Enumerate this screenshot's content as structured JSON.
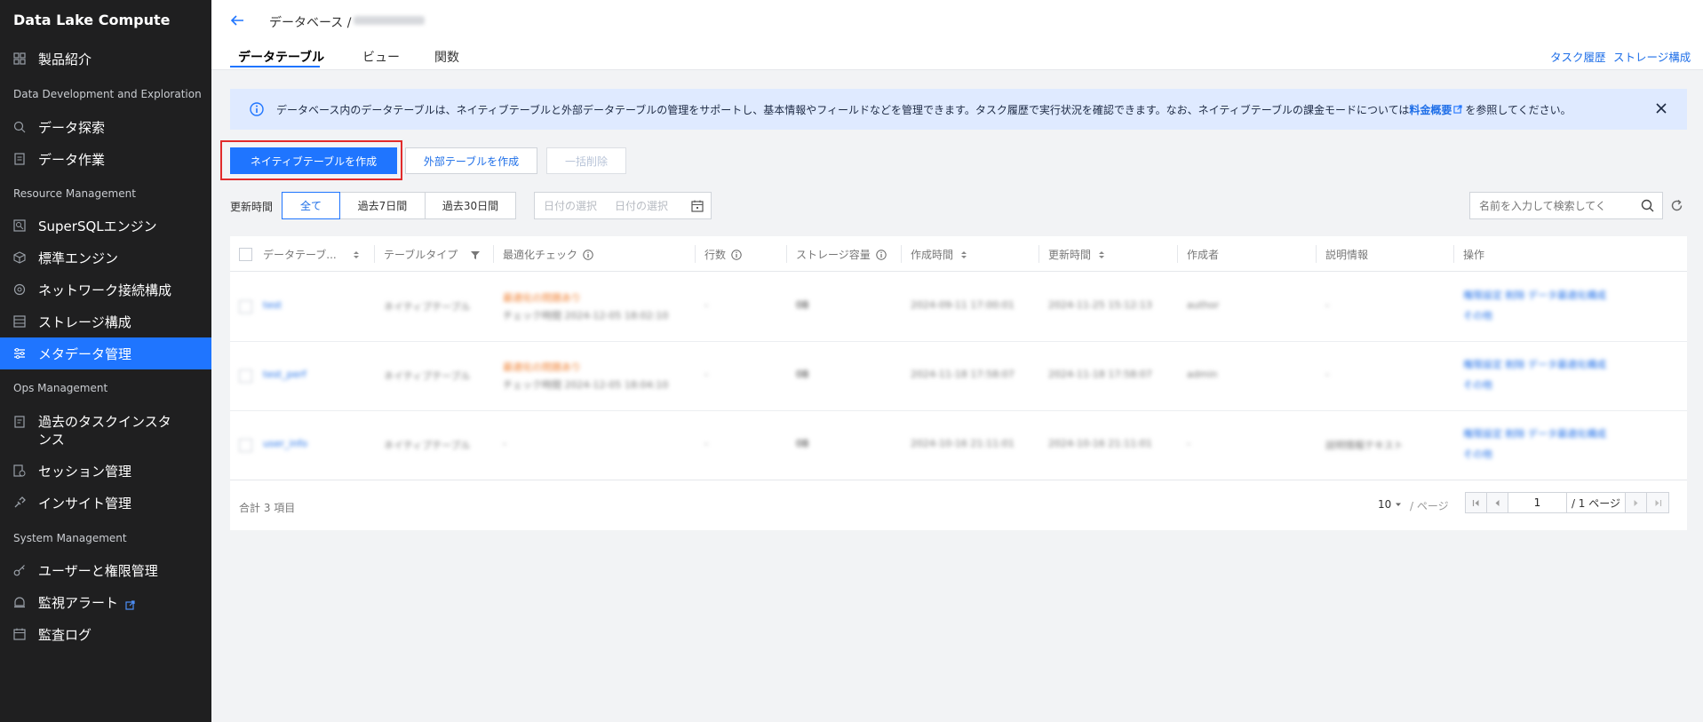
{
  "app": {
    "title": "Data Lake Compute"
  },
  "sidebar": {
    "top_item": {
      "label": "製品紹介",
      "icon": "grid-icon"
    },
    "sections": {
      "dev": "Data Development and Exploration",
      "resource": "Resource Management",
      "ops": "Ops Management",
      "system": "System Management"
    },
    "dev_items": [
      {
        "label": "データ探索",
        "icon": "search-data-icon"
      },
      {
        "label": "データ作業",
        "icon": "document-icon"
      }
    ],
    "resource_items": [
      {
        "label": "SuperSQLエンジン",
        "icon": "sql-engine-icon"
      },
      {
        "label": "標準エンジン",
        "icon": "cube-icon"
      },
      {
        "label": "ネットワーク接続構成",
        "icon": "network-icon"
      },
      {
        "label": "ストレージ構成",
        "icon": "storage-icon"
      },
      {
        "label": "メタデータ管理",
        "icon": "metadata-icon"
      }
    ],
    "ops_items": [
      {
        "label": "過去のタスクインスタンス",
        "icon": "task-history-icon"
      },
      {
        "label": "セッション管理",
        "icon": "session-icon"
      },
      {
        "label": "インサイト管理",
        "icon": "insight-icon"
      }
    ],
    "system_items": [
      {
        "label": "ユーザーと権限管理",
        "icon": "key-icon"
      },
      {
        "label": "監視アラート",
        "icon": "alarm-icon"
      },
      {
        "label": "監査ログ",
        "icon": "calendar-log-icon"
      }
    ]
  },
  "header": {
    "breadcrumb": "データベース /",
    "tabs": [
      "データテーブル",
      "ビュー",
      "関数"
    ],
    "links": {
      "task_history": "タスク履歴",
      "storage_config": "ストレージ構成"
    }
  },
  "banner": {
    "text_before": "データベース内のデータテーブルは、ネイティブテーブルと外部データテーブルの管理をサポートし、基本情報やフィールドなどを管理できます。タスク履歴で実行状況を確認できます。なお、ネイティブテーブルの課金モードについては",
    "link": "料金概要",
    "text_after": "を参照してください。"
  },
  "actions": {
    "create_native": "ネイティブテーブルを作成",
    "create_external": "外部テーブルを作成",
    "bulk_delete": "一括削除"
  },
  "filters": {
    "label": "更新時間",
    "segments": [
      "全て",
      "過去7日間",
      "過去30日間"
    ],
    "date_start": "日付の選択",
    "date_end": "日付の選択",
    "search_placeholder": "名前を入力して検索してく"
  },
  "table": {
    "columns": [
      "データテーブ...",
      "テーブルタイプ",
      "最適化チェック",
      "行数",
      "ストレージ容量",
      "作成時間",
      "更新時間",
      "作成者",
      "説明情報",
      "操作"
    ],
    "rows": [
      {
        "name": "test",
        "type": "ネイティブテーブル",
        "opt1": "最適化の問題あり",
        "opt2": "チェック時間 2024-12-05 18:02:10",
        "rows": "-",
        "storage": "0B",
        "created": "2024-09-11 17:00:01",
        "updated": "2024-11-25 15:12:13",
        "creator": "author",
        "desc": "-",
        "ops1": "権限設定 削除 データ最適化構成",
        "ops2": "その他"
      },
      {
        "name": "test_perf",
        "type": "ネイティブテーブル",
        "opt1": "最適化の問題あり",
        "opt2": "チェック時間 2024-12-05 18:04:10",
        "rows": "-",
        "storage": "0B",
        "created": "2024-11-18 17:58:07",
        "updated": "2024-11-18 17:58:07",
        "creator": "admin",
        "desc": "-",
        "ops1": "権限設定 削除 データ最適化構成",
        "ops2": "その他"
      },
      {
        "name": "user_info",
        "type": "ネイティブテーブル",
        "opt1": "-",
        "opt2": "",
        "rows": "-",
        "storage": "0B",
        "created": "2024-10-16 21:11:01",
        "updated": "2024-10-16 21:11:01",
        "creator": "-",
        "desc": "説明情報テキスト",
        "ops1": "権限設定 削除 データ最適化構成",
        "ops2": "その他"
      }
    ],
    "total": "合計 3 項目",
    "page_size": "10",
    "per_page": "/ ページ",
    "page": "1",
    "page_total": "/ 1 ページ"
  },
  "colors": {
    "accent": "#1f75ff",
    "sidebar_bg": "#1f1f20",
    "highlight": "#e12b2b",
    "banner_bg": "#dfeaff"
  }
}
